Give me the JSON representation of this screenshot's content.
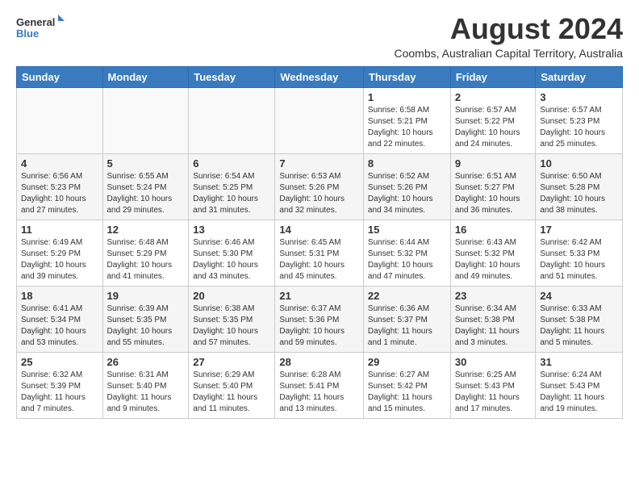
{
  "logo": {
    "general": "General",
    "blue": "Blue"
  },
  "title": "August 2024",
  "subtitle": "Coombs, Australian Capital Territory, Australia",
  "weekdays": [
    "Sunday",
    "Monday",
    "Tuesday",
    "Wednesday",
    "Thursday",
    "Friday",
    "Saturday"
  ],
  "weeks": [
    [
      {
        "day": "",
        "info": ""
      },
      {
        "day": "",
        "info": ""
      },
      {
        "day": "",
        "info": ""
      },
      {
        "day": "",
        "info": ""
      },
      {
        "day": "1",
        "info": "Sunrise: 6:58 AM\nSunset: 5:21 PM\nDaylight: 10 hours\nand 22 minutes."
      },
      {
        "day": "2",
        "info": "Sunrise: 6:57 AM\nSunset: 5:22 PM\nDaylight: 10 hours\nand 24 minutes."
      },
      {
        "day": "3",
        "info": "Sunrise: 6:57 AM\nSunset: 5:23 PM\nDaylight: 10 hours\nand 25 minutes."
      }
    ],
    [
      {
        "day": "4",
        "info": "Sunrise: 6:56 AM\nSunset: 5:23 PM\nDaylight: 10 hours\nand 27 minutes."
      },
      {
        "day": "5",
        "info": "Sunrise: 6:55 AM\nSunset: 5:24 PM\nDaylight: 10 hours\nand 29 minutes."
      },
      {
        "day": "6",
        "info": "Sunrise: 6:54 AM\nSunset: 5:25 PM\nDaylight: 10 hours\nand 31 minutes."
      },
      {
        "day": "7",
        "info": "Sunrise: 6:53 AM\nSunset: 5:26 PM\nDaylight: 10 hours\nand 32 minutes."
      },
      {
        "day": "8",
        "info": "Sunrise: 6:52 AM\nSunset: 5:26 PM\nDaylight: 10 hours\nand 34 minutes."
      },
      {
        "day": "9",
        "info": "Sunrise: 6:51 AM\nSunset: 5:27 PM\nDaylight: 10 hours\nand 36 minutes."
      },
      {
        "day": "10",
        "info": "Sunrise: 6:50 AM\nSunset: 5:28 PM\nDaylight: 10 hours\nand 38 minutes."
      }
    ],
    [
      {
        "day": "11",
        "info": "Sunrise: 6:49 AM\nSunset: 5:29 PM\nDaylight: 10 hours\nand 39 minutes."
      },
      {
        "day": "12",
        "info": "Sunrise: 6:48 AM\nSunset: 5:29 PM\nDaylight: 10 hours\nand 41 minutes."
      },
      {
        "day": "13",
        "info": "Sunrise: 6:46 AM\nSunset: 5:30 PM\nDaylight: 10 hours\nand 43 minutes."
      },
      {
        "day": "14",
        "info": "Sunrise: 6:45 AM\nSunset: 5:31 PM\nDaylight: 10 hours\nand 45 minutes."
      },
      {
        "day": "15",
        "info": "Sunrise: 6:44 AM\nSunset: 5:32 PM\nDaylight: 10 hours\nand 47 minutes."
      },
      {
        "day": "16",
        "info": "Sunrise: 6:43 AM\nSunset: 5:32 PM\nDaylight: 10 hours\nand 49 minutes."
      },
      {
        "day": "17",
        "info": "Sunrise: 6:42 AM\nSunset: 5:33 PM\nDaylight: 10 hours\nand 51 minutes."
      }
    ],
    [
      {
        "day": "18",
        "info": "Sunrise: 6:41 AM\nSunset: 5:34 PM\nDaylight: 10 hours\nand 53 minutes."
      },
      {
        "day": "19",
        "info": "Sunrise: 6:39 AM\nSunset: 5:35 PM\nDaylight: 10 hours\nand 55 minutes."
      },
      {
        "day": "20",
        "info": "Sunrise: 6:38 AM\nSunset: 5:35 PM\nDaylight: 10 hours\nand 57 minutes."
      },
      {
        "day": "21",
        "info": "Sunrise: 6:37 AM\nSunset: 5:36 PM\nDaylight: 10 hours\nand 59 minutes."
      },
      {
        "day": "22",
        "info": "Sunrise: 6:36 AM\nSunset: 5:37 PM\nDaylight: 11 hours\nand 1 minute."
      },
      {
        "day": "23",
        "info": "Sunrise: 6:34 AM\nSunset: 5:38 PM\nDaylight: 11 hours\nand 3 minutes."
      },
      {
        "day": "24",
        "info": "Sunrise: 6:33 AM\nSunset: 5:38 PM\nDaylight: 11 hours\nand 5 minutes."
      }
    ],
    [
      {
        "day": "25",
        "info": "Sunrise: 6:32 AM\nSunset: 5:39 PM\nDaylight: 11 hours\nand 7 minutes."
      },
      {
        "day": "26",
        "info": "Sunrise: 6:31 AM\nSunset: 5:40 PM\nDaylight: 11 hours\nand 9 minutes."
      },
      {
        "day": "27",
        "info": "Sunrise: 6:29 AM\nSunset: 5:40 PM\nDaylight: 11 hours\nand 11 minutes."
      },
      {
        "day": "28",
        "info": "Sunrise: 6:28 AM\nSunset: 5:41 PM\nDaylight: 11 hours\nand 13 minutes."
      },
      {
        "day": "29",
        "info": "Sunrise: 6:27 AM\nSunset: 5:42 PM\nDaylight: 11 hours\nand 15 minutes."
      },
      {
        "day": "30",
        "info": "Sunrise: 6:25 AM\nSunset: 5:43 PM\nDaylight: 11 hours\nand 17 minutes."
      },
      {
        "day": "31",
        "info": "Sunrise: 6:24 AM\nSunset: 5:43 PM\nDaylight: 11 hours\nand 19 minutes."
      }
    ]
  ]
}
